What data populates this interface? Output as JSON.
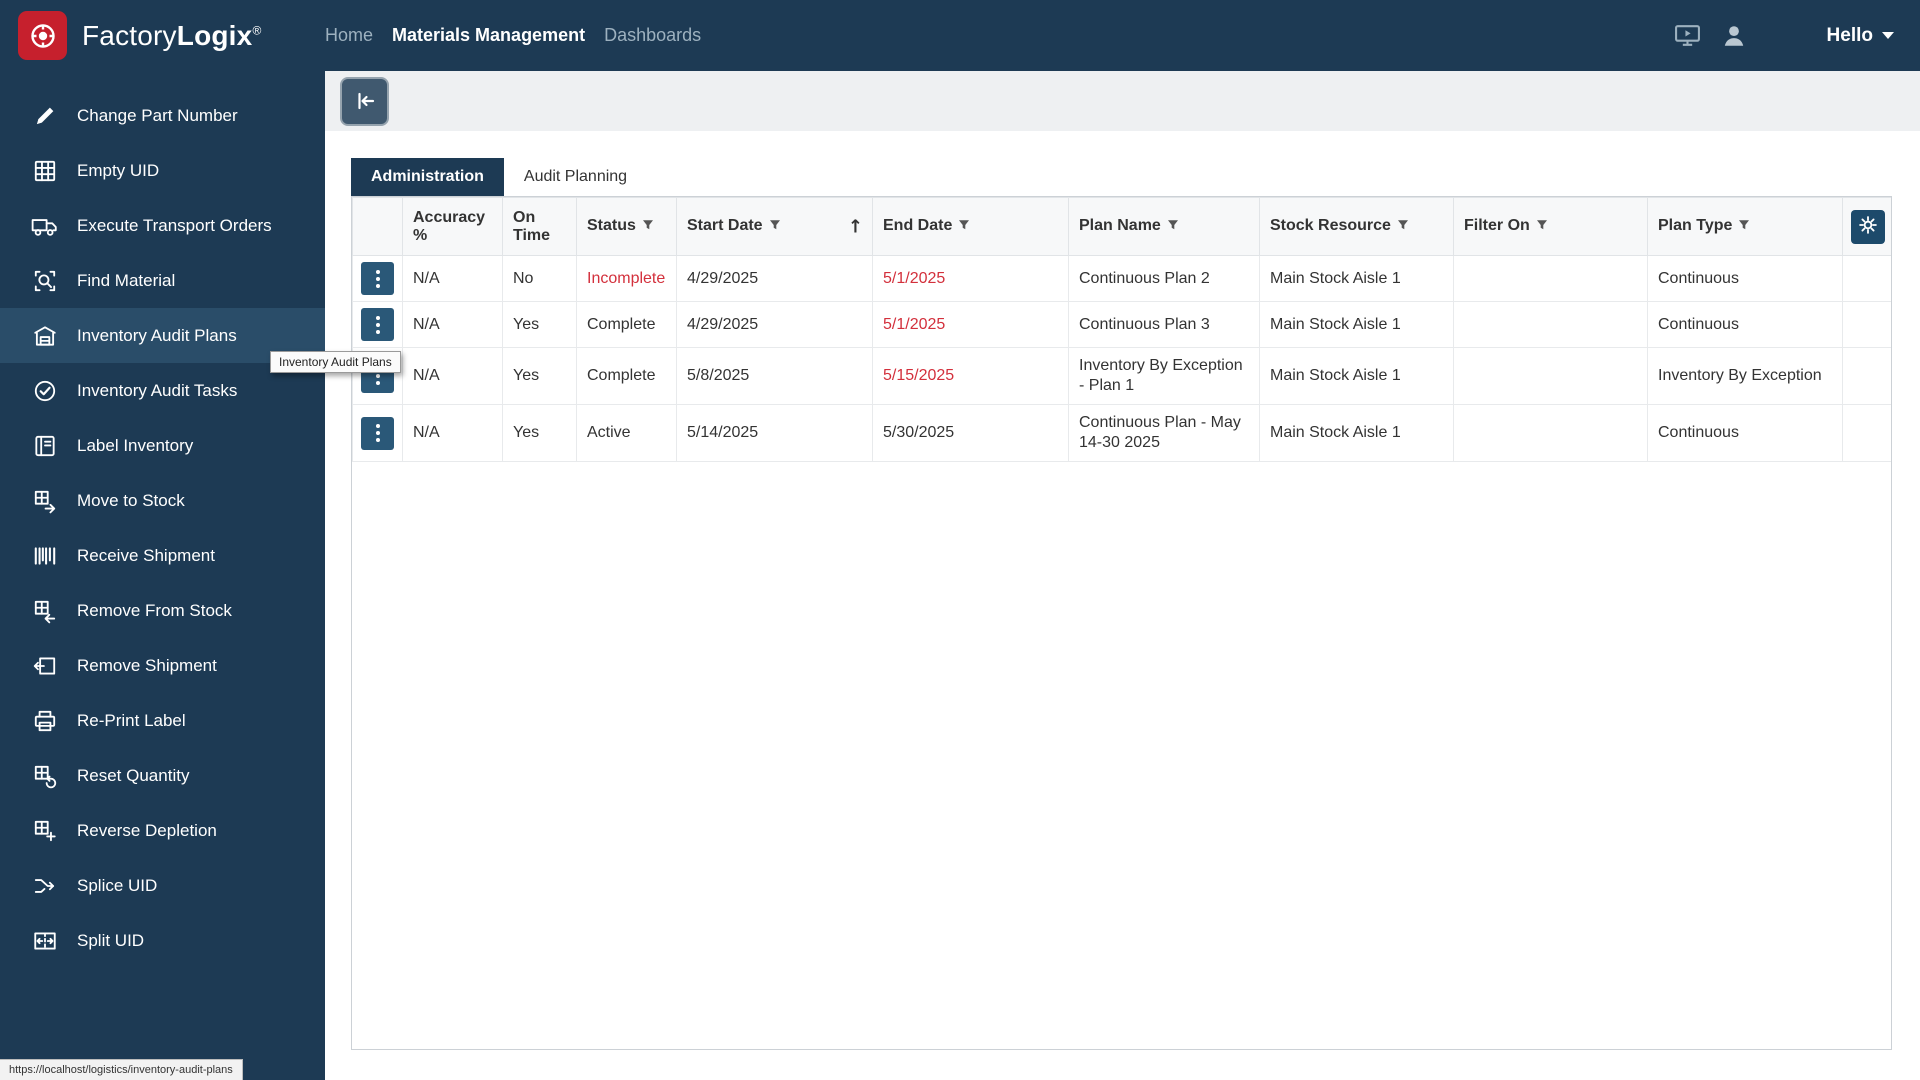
{
  "topbar": {
    "brand_regular": "Factory",
    "brand_bold": "Logix",
    "brand_mark": "®",
    "nav": [
      {
        "label": "Home",
        "active": false
      },
      {
        "label": "Materials Management",
        "active": true
      },
      {
        "label": "Dashboards",
        "active": false
      }
    ],
    "greeting": "Hello"
  },
  "sidebar": {
    "items": [
      {
        "label": "Change Part Number",
        "icon": "edit-clipboard-icon",
        "active": false
      },
      {
        "label": "Empty UID",
        "icon": "grid-empty-icon",
        "active": false
      },
      {
        "label": "Execute Transport Orders",
        "icon": "truck-icon",
        "active": false
      },
      {
        "label": "Find Material",
        "icon": "search-box-icon",
        "active": false
      },
      {
        "label": "Inventory Audit Plans",
        "icon": "audit-plans-icon",
        "active": true
      },
      {
        "label": "Inventory Audit Tasks",
        "icon": "audit-tasks-icon",
        "active": false
      },
      {
        "label": "Label Inventory",
        "icon": "label-icon",
        "active": false
      },
      {
        "label": "Move to Stock",
        "icon": "move-stock-icon",
        "active": false
      },
      {
        "label": "Receive Shipment",
        "icon": "barcode-icon",
        "active": false
      },
      {
        "label": "Remove From Stock",
        "icon": "remove-stock-icon",
        "active": false
      },
      {
        "label": "Remove Shipment",
        "icon": "remove-shipment-icon",
        "active": false
      },
      {
        "label": "Re-Print Label",
        "icon": "printer-icon",
        "active": false
      },
      {
        "label": "Reset Quantity",
        "icon": "reset-icon",
        "active": false
      },
      {
        "label": "Reverse Depletion",
        "icon": "reverse-depletion-icon",
        "active": false
      },
      {
        "label": "Splice UID",
        "icon": "splice-icon",
        "active": false
      },
      {
        "label": "Split UID",
        "icon": "split-icon",
        "active": false
      }
    ],
    "tooltip": "Inventory Audit Plans",
    "status_url": "https://localhost/logistics/inventory-audit-plans"
  },
  "content": {
    "tabs": [
      {
        "label": "Administration",
        "active": true
      },
      {
        "label": "Audit Planning",
        "active": false
      }
    ],
    "table": {
      "columns": [
        {
          "type": "actions",
          "label": ""
        },
        {
          "label": "Accuracy %",
          "filter": false
        },
        {
          "label": "On Time",
          "filter": false
        },
        {
          "label": "Status",
          "filter": true
        },
        {
          "label": "Start Date",
          "filter": true,
          "sort": "asc"
        },
        {
          "label": "End Date",
          "filter": true
        },
        {
          "label": "Plan Name",
          "filter": true
        },
        {
          "label": "Stock Resource",
          "filter": true
        },
        {
          "label": "Filter On",
          "filter": true
        },
        {
          "label": "Plan Type",
          "filter": true
        },
        {
          "type": "settings",
          "label": ""
        }
      ],
      "rows": [
        {
          "accuracy": "N/A",
          "on_time": "No",
          "status": "Incomplete",
          "status_red": true,
          "start_date": "4/29/2025",
          "end_date": "5/1/2025",
          "end_date_red": true,
          "plan_name": "Continuous Plan 2",
          "stock_resource": "Main Stock Aisle 1",
          "filter_on": "",
          "plan_type": "Continuous"
        },
        {
          "accuracy": "N/A",
          "on_time": "Yes",
          "status": "Complete",
          "status_red": false,
          "start_date": "4/29/2025",
          "end_date": "5/1/2025",
          "end_date_red": true,
          "plan_name": "Continuous Plan 3",
          "stock_resource": "Main Stock Aisle 1",
          "filter_on": "",
          "plan_type": "Continuous"
        },
        {
          "accuracy": "N/A",
          "on_time": "Yes",
          "status": "Complete",
          "status_red": false,
          "start_date": "5/8/2025",
          "end_date": "5/15/2025",
          "end_date_red": true,
          "plan_name": "Inventory By Exception - Plan 1",
          "stock_resource": "Main Stock Aisle 1",
          "filter_on": "",
          "plan_type": "Inventory By Exception"
        },
        {
          "accuracy": "N/A",
          "on_time": "Yes",
          "status": "Active",
          "status_red": false,
          "start_date": "5/14/2025",
          "end_date": "5/30/2025",
          "end_date_red": false,
          "plan_name": "Continuous Plan - May 14-30 2025",
          "stock_resource": "Main Stock Aisle 1",
          "filter_on": "",
          "plan_type": "Continuous"
        }
      ]
    }
  },
  "colors": {
    "navy": "#1d3a54",
    "sidebar_active": "#2a4d69",
    "brand_red": "#c6202d",
    "alert_red": "#d3303c"
  }
}
